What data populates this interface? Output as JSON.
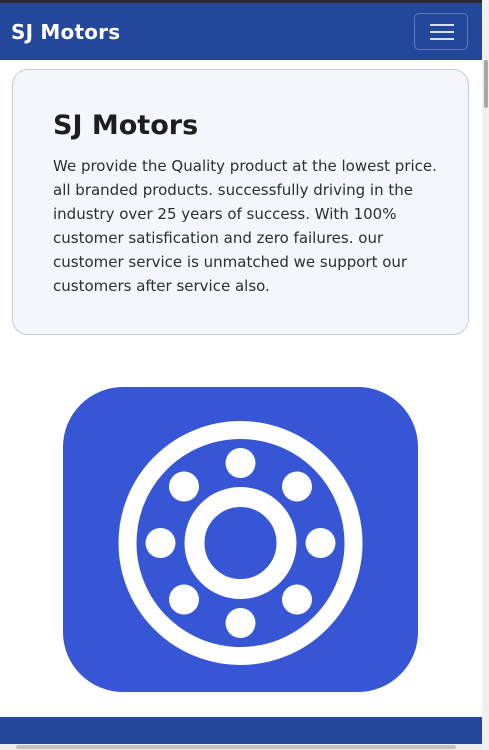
{
  "navbar": {
    "brand": "SJ Motors",
    "toggler_icon": "hamburger-menu-icon"
  },
  "hero": {
    "title": "SJ Motors",
    "description": "We provide the Quality product at the lowest price. all branded products. successfully driving in the industry over 25 years of success. With 100% customer satisfication and zero failures. our customer service is unmatched we support our customers after service also."
  },
  "logo": {
    "icon": "ball-bearing-icon"
  },
  "colors": {
    "primary": "#23479a",
    "logo_background": "#3656d6",
    "card_background": "#f3f6fa"
  }
}
